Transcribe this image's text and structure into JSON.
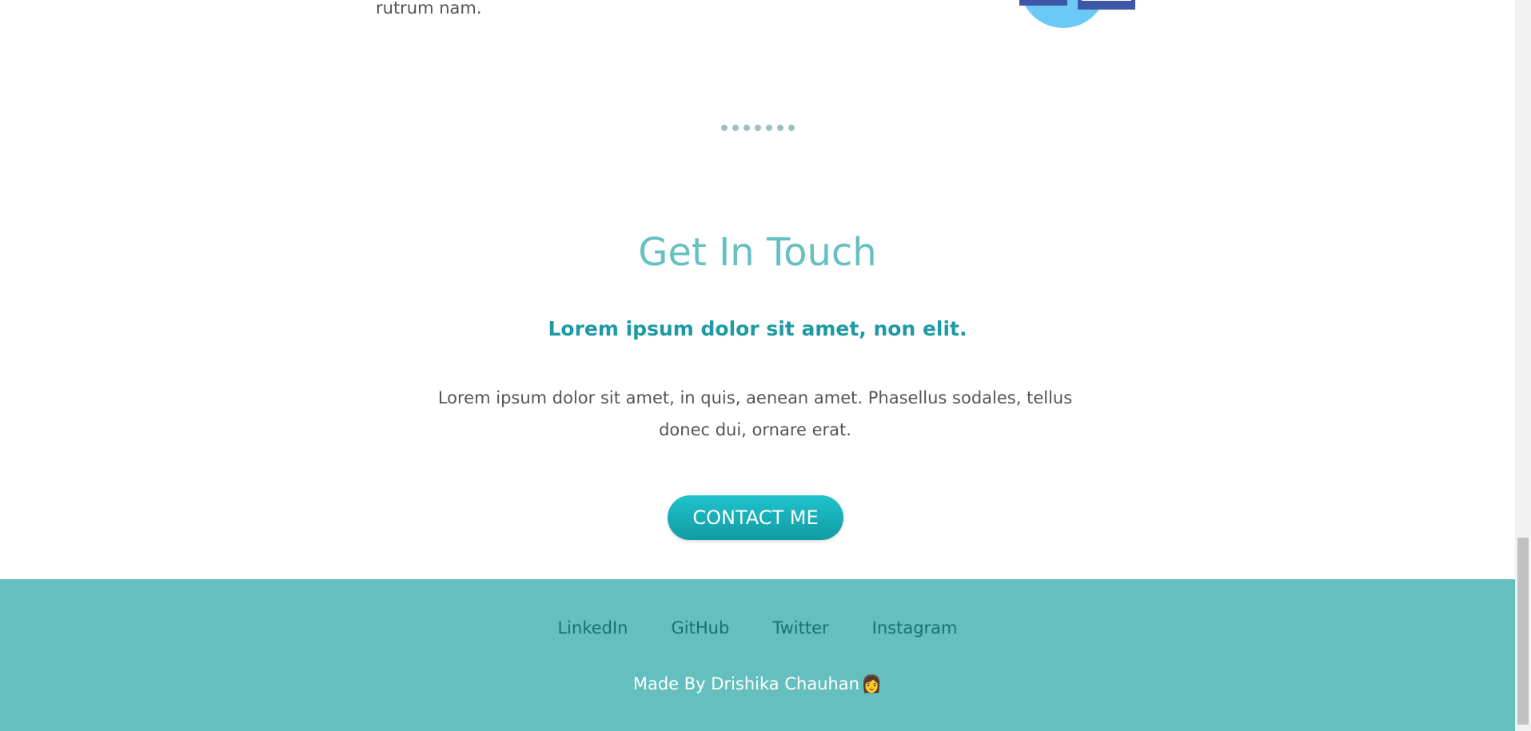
{
  "previous_section": {
    "text_tail": "rutrum nam."
  },
  "divider": {
    "dot_count": 7
  },
  "contact": {
    "title": "Get In Touch",
    "subtitle": "Lorem ipsum dolor sit amet, non elit.",
    "body": "Lorem ipsum dolor sit amet, in quis, aenean amet. Phasellus sodales, tellus donec dui, ornare erat.",
    "button_label": "CONTACT ME"
  },
  "footer": {
    "links": [
      {
        "label": "LinkedIn"
      },
      {
        "label": "GitHub"
      },
      {
        "label": "Twitter"
      },
      {
        "label": "Instagram"
      }
    ],
    "credit": "Made By Drishika Chauhan",
    "credit_emoji": "👩"
  },
  "colors": {
    "accent": "#66bfbf",
    "title": "#66c0c0",
    "subtitle": "#1e9aa3",
    "button": "#1fc3cc",
    "link": "#1a6f74"
  }
}
